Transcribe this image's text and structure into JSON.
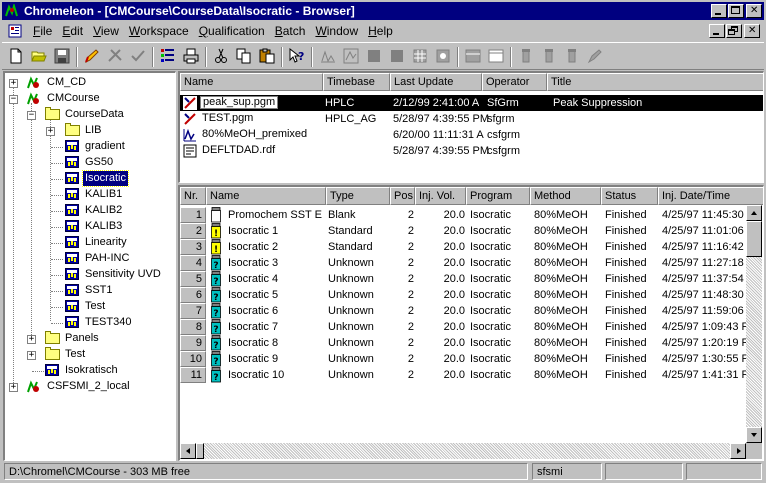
{
  "window": {
    "title": "Chromeleon - [CMCourse\\CourseData\\Isocratic - Browser]"
  },
  "menu": [
    {
      "key": "file",
      "ul": "F",
      "rest": "ile"
    },
    {
      "key": "edit",
      "ul": "E",
      "rest": "dit"
    },
    {
      "key": "view",
      "ul": "V",
      "rest": "iew"
    },
    {
      "key": "workspace",
      "ul": "W",
      "rest": "orkspace"
    },
    {
      "key": "qualification",
      "ul": "Q",
      "rest": "ualification"
    },
    {
      "key": "batch",
      "ul": "B",
      "rest": "atch"
    },
    {
      "key": "window",
      "ul": "W",
      "rest": "indow"
    },
    {
      "key": "help",
      "ul": "H",
      "rest": "elp"
    }
  ],
  "tree": {
    "cm_cd": "CM_CD",
    "cmcourse": "CMCourse",
    "coursedata": "CourseData",
    "lib": "LIB",
    "gradient": "gradient",
    "gs50": "GS50",
    "isocratic": "Isocratic",
    "kalib1": "KALIB1",
    "kalib2": "KALIB2",
    "kalib3": "KALIB3",
    "linearity": "Linearity",
    "pah_inc": "PAH-INC",
    "sensitivity": "Sensitivity UVD",
    "sst1": "SST1",
    "test": "Test",
    "test340": "TEST340",
    "panels": "Panels",
    "test_folder": "Test",
    "isokratisch": "Isokratisch",
    "csfsmi": "CSFSMI_2_local"
  },
  "files": {
    "headers": {
      "name": "Name",
      "timebase": "Timebase",
      "last_update": "Last Update",
      "operator": "Operator",
      "title": "Title"
    },
    "rows": [
      {
        "name": "peak_sup.pgm",
        "timebase": "HPLC",
        "last_update": "2/12/99 2:41:00 A",
        "operator": "SfGrm",
        "title": "Peak Suppression"
      },
      {
        "name": "TEST.pgm",
        "timebase": "HPLC_AG",
        "last_update": "5/28/97 4:39:55 PM",
        "operator": "sfgrm",
        "title": ""
      },
      {
        "name": "80%MeOH_premixed",
        "timebase": "",
        "last_update": "6/20/00 11:11:31 A",
        "operator": "csfgrm",
        "title": ""
      },
      {
        "name": "DEFLTDAD.rdf",
        "timebase": "",
        "last_update": "5/28/97 4:39:55 PM",
        "operator": "csfgrm",
        "title": ""
      }
    ]
  },
  "sequence": {
    "headers": {
      "nr": "Nr.",
      "name": "Name",
      "type": "Type",
      "pos": "Pos",
      "inj_vol": "Inj. Vol.",
      "program": "Program",
      "method": "Method",
      "status": "Status",
      "inj_date": "Inj. Date/Time"
    },
    "rows": [
      {
        "nr": "1",
        "name": "Promochem SST Ei",
        "type": "Blank",
        "pos": "2",
        "inj_vol": "20.0",
        "program": "Isocratic",
        "method": "80%MeOH",
        "status": "Finished",
        "inj_date": "4/25/97 11:45:30"
      },
      {
        "nr": "2",
        "name": "Isocratic 1",
        "type": "Standard",
        "pos": "2",
        "inj_vol": "20.0",
        "program": "Isocratic",
        "method": "80%MeOH",
        "status": "Finished",
        "inj_date": "4/25/97 11:01:06"
      },
      {
        "nr": "3",
        "name": "Isocratic 2",
        "type": "Standard",
        "pos": "2",
        "inj_vol": "20.0",
        "program": "Isocratic",
        "method": "80%MeOH",
        "status": "Finished",
        "inj_date": "4/25/97 11:16:42"
      },
      {
        "nr": "4",
        "name": "Isocratic 3",
        "type": "Unknown",
        "pos": "2",
        "inj_vol": "20.0",
        "program": "Isocratic",
        "method": "80%MeOH",
        "status": "Finished",
        "inj_date": "4/25/97 11:27:18"
      },
      {
        "nr": "5",
        "name": "Isocratic 4",
        "type": "Unknown",
        "pos": "2",
        "inj_vol": "20.0",
        "program": "Isocratic",
        "method": "80%MeOH",
        "status": "Finished",
        "inj_date": "4/25/97 11:37:54"
      },
      {
        "nr": "6",
        "name": "Isocratic 5",
        "type": "Unknown",
        "pos": "2",
        "inj_vol": "20.0",
        "program": "Isocratic",
        "method": "80%MeOH",
        "status": "Finished",
        "inj_date": "4/25/97 11:48:30"
      },
      {
        "nr": "7",
        "name": "Isocratic 6",
        "type": "Unknown",
        "pos": "2",
        "inj_vol": "20.0",
        "program": "Isocratic",
        "method": "80%MeOH",
        "status": "Finished",
        "inj_date": "4/25/97 11:59:06"
      },
      {
        "nr": "8",
        "name": "Isocratic 7",
        "type": "Unknown",
        "pos": "2",
        "inj_vol": "20.0",
        "program": "Isocratic",
        "method": "80%MeOH",
        "status": "Finished",
        "inj_date": "4/25/97 1:09:43 F"
      },
      {
        "nr": "9",
        "name": "Isocratic 8",
        "type": "Unknown",
        "pos": "2",
        "inj_vol": "20.0",
        "program": "Isocratic",
        "method": "80%MeOH",
        "status": "Finished",
        "inj_date": "4/25/97 1:20:19 F"
      },
      {
        "nr": "10",
        "name": "Isocratic 9",
        "type": "Unknown",
        "pos": "2",
        "inj_vol": "20.0",
        "program": "Isocratic",
        "method": "80%MeOH",
        "status": "Finished",
        "inj_date": "4/25/97 1:30:55 F"
      },
      {
        "nr": "11",
        "name": "Isocratic 10",
        "type": "Unknown",
        "pos": "2",
        "inj_vol": "20.0",
        "program": "Isocratic",
        "method": "80%MeOH",
        "status": "Finished",
        "inj_date": "4/25/97 1:41:31 F"
      }
    ]
  },
  "status": {
    "path": "D:\\Chromel\\CMCourse - 303 MB free",
    "user": "sfsmi"
  },
  "colors": {
    "title_bar": "#000080",
    "selection": "#000080",
    "vial_yellow": "#ffff00",
    "vial_teal": "#00c0c0"
  }
}
